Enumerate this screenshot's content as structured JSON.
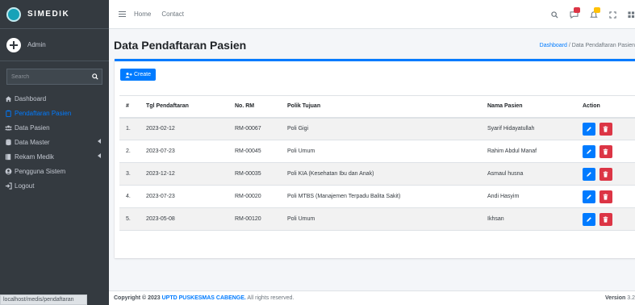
{
  "brand": {
    "name": "SIMEDIK"
  },
  "user": {
    "name": "Admin"
  },
  "search": {
    "placeholder": "Search"
  },
  "nav": {
    "items": [
      {
        "label": "Dashboard",
        "icon": "home-icon"
      },
      {
        "label": "Pendaftaran Pasien",
        "icon": "clipboard-icon",
        "active": true
      },
      {
        "label": "Data Pasien",
        "icon": "users-icon"
      },
      {
        "label": "Data Master",
        "icon": "database-icon",
        "expandable": true
      },
      {
        "label": "Rekam Medik",
        "icon": "book-icon",
        "expandable": true
      },
      {
        "label": "Pengguna Sistem",
        "icon": "user-circle-icon"
      },
      {
        "label": "Logout",
        "icon": "logout-icon"
      }
    ]
  },
  "status_url": "localhost/medis/pendaftaran",
  "topbar": {
    "home": "Home",
    "contact": "Contact"
  },
  "page": {
    "title": "Data Pendaftaran Pasien"
  },
  "breadcrumb": {
    "home": "Dashboard",
    "separator": "/",
    "current": "Data Pendaftaran Pasien"
  },
  "toolbar": {
    "create_label": "Create"
  },
  "table": {
    "headers": {
      "no": "#",
      "tgl": "Tgl Pendaftaran",
      "rm": "No. RM",
      "poli": "Polik Tujuan",
      "nama": "Nama Pasien",
      "action": "Action"
    },
    "rows": [
      {
        "no": "1.",
        "tgl": "2023-02-12",
        "rm": "RM-00067",
        "poli": "Poli Gigi",
        "nama": "Syarif Hidayatullah"
      },
      {
        "no": "2.",
        "tgl": "2023-07-23",
        "rm": "RM-00045",
        "poli": "Poli Umum",
        "nama": "Rahim Abdul Manaf"
      },
      {
        "no": "3.",
        "tgl": "2023-12-12",
        "rm": "RM-00035",
        "poli": "Poli KIA (Kesehatan Ibu dan Anak)",
        "nama": "Asmaul husna"
      },
      {
        "no": "4.",
        "tgl": "2023-07-23",
        "rm": "RM-00020",
        "poli": "Poli MTBS (Manajemen Terpadu Balita Sakit)",
        "nama": "Andi Hasyim"
      },
      {
        "no": "5.",
        "tgl": "2023-05-08",
        "rm": "RM-00120",
        "poli": "Poli Umum",
        "nama": "Ikhsan"
      }
    ]
  },
  "footer": {
    "prefix": "Copyright © 2023 ",
    "brand": "UPTD PUSKESMAS CABENGE.",
    "suffix": " All rights reserved.",
    "version_label": "Version",
    "version": "3.2"
  },
  "colors": {
    "primary": "#007bff",
    "danger": "#dc3545",
    "sidebar": "#343a40",
    "badge_red": "#dc3545",
    "badge_yellow": "#ffc107"
  }
}
